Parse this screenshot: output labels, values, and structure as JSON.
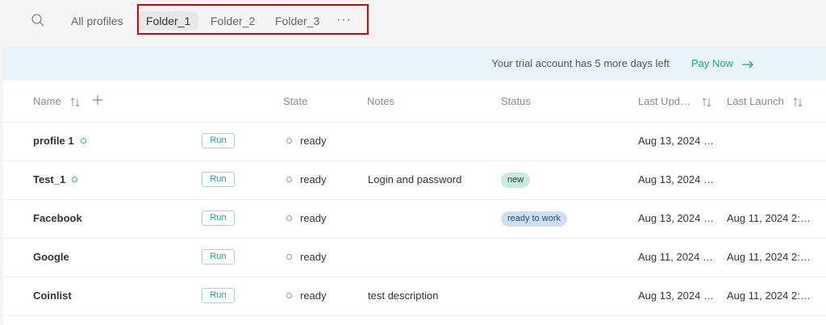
{
  "topbar": {
    "all_profiles": "All profiles",
    "folders": [
      {
        "label": "Folder_1"
      },
      {
        "label": "Folder_2"
      },
      {
        "label": "Folder_3"
      }
    ],
    "more_label": "···"
  },
  "trial": {
    "message": "Your trial account has 5 more days left",
    "pay_now": "Pay Now"
  },
  "table": {
    "headers": {
      "name": "Name",
      "state": "State",
      "notes": "Notes",
      "status": "Status",
      "last_updated": "Last Upd…",
      "last_launch": "Last Launch"
    },
    "run_label": "Run",
    "rows": [
      {
        "name": "profile 1",
        "state": "ready",
        "notes": "",
        "status": "",
        "last_updated": "Aug 13, 2024 …",
        "last_launch": ""
      },
      {
        "name": "Test_1",
        "state": "ready",
        "notes": "Login and password",
        "status": "new",
        "last_updated": "Aug 13, 2024 …",
        "last_launch": ""
      },
      {
        "name": "Facebook",
        "state": "ready",
        "notes": "",
        "status": "ready to work",
        "last_updated": "Aug 13, 2024 …",
        "last_launch": "Aug 11, 2024 2:…"
      },
      {
        "name": "Google",
        "state": "ready",
        "notes": "",
        "status": "",
        "last_updated": "Aug 11, 2024 …",
        "last_launch": "Aug 11, 2024 2:…"
      },
      {
        "name": "Coinlist",
        "state": "ready",
        "notes": "test description",
        "status": "",
        "last_updated": "Aug 13, 2024 …",
        "last_launch": "Aug 11, 2024 2:…"
      }
    ]
  },
  "colors": {
    "accent": "#1aa589",
    "highlight_box": "#e00000",
    "trial_bg": "#e8f4f9",
    "badge_new": "#c8ece0",
    "badge_ready": "#cfe0f6"
  },
  "icons": [
    "search-icon",
    "sort-icon",
    "add-icon",
    "more-icon",
    "arrow-right-icon",
    "status-dot-icon"
  ]
}
